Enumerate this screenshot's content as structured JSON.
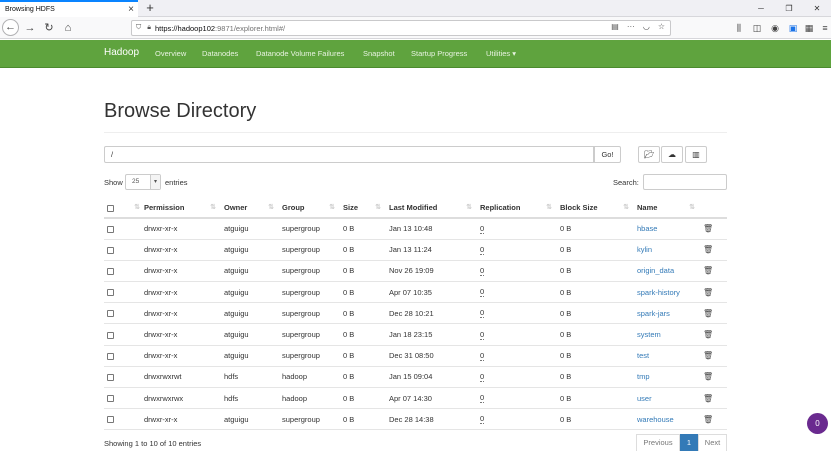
{
  "browser": {
    "tab_title": "Browsing HDFS",
    "tab_close": "×",
    "new_tab": "+",
    "url_host": "https://hadoop102",
    "url_path": ":9871/explorer.html#/",
    "url_more": "···",
    "win_min": "─",
    "win_restore": "❐",
    "win_close": "✕"
  },
  "nav": {
    "brand": "Hadoop",
    "links": [
      "Overview",
      "Datanodes",
      "Datanode Volume Failures",
      "Snapshot",
      "Startup Progress",
      "Utilities ▾"
    ]
  },
  "page": {
    "title": "Browse Directory",
    "path_value": "/",
    "go_label": "Go!",
    "show_label": "Show",
    "entries_value": "25",
    "entries_label": "entries",
    "search_label": "Search:",
    "showing_text": "Showing 1 to 10 of 10 entries",
    "pagination": {
      "previous": "Previous",
      "current": "1",
      "next": "Next"
    },
    "fab_badge": "0"
  },
  "table": {
    "headers": [
      "Permission",
      "Owner",
      "Group",
      "Size",
      "Last Modified",
      "Replication",
      "Block Size",
      "Name"
    ],
    "rows": [
      [
        "drwxr-xr-x",
        "atguigu",
        "supergroup",
        "0 B",
        "Jan 13 10:48",
        "0",
        "0 B",
        "hbase"
      ],
      [
        "drwxr-xr-x",
        "atguigu",
        "supergroup",
        "0 B",
        "Jan 13 11:24",
        "0",
        "0 B",
        "kylin"
      ],
      [
        "drwxr-xr-x",
        "atguigu",
        "supergroup",
        "0 B",
        "Nov 26 19:09",
        "0",
        "0 B",
        "origin_data"
      ],
      [
        "drwxr-xr-x",
        "atguigu",
        "supergroup",
        "0 B",
        "Apr 07 10:35",
        "0",
        "0 B",
        "spark-history"
      ],
      [
        "drwxr-xr-x",
        "atguigu",
        "supergroup",
        "0 B",
        "Dec 28 10:21",
        "0",
        "0 B",
        "spark-jars"
      ],
      [
        "drwxr-xr-x",
        "atguigu",
        "supergroup",
        "0 B",
        "Jan 18 23:15",
        "0",
        "0 B",
        "system"
      ],
      [
        "drwxr-xr-x",
        "atguigu",
        "supergroup",
        "0 B",
        "Dec 31 08:50",
        "0",
        "0 B",
        "test"
      ],
      [
        "drwxrwxrwt",
        "hdfs",
        "hadoop",
        "0 B",
        "Jan 15 09:04",
        "0",
        "0 B",
        "tmp"
      ],
      [
        "drwxrwxrwx",
        "hdfs",
        "hadoop",
        "0 B",
        "Apr 07 14:30",
        "0",
        "0 B",
        "user"
      ],
      [
        "drwxr-xr-x",
        "atguigu",
        "supergroup",
        "0 B",
        "Dec 28 14:38",
        "0",
        "0 B",
        "warehouse"
      ]
    ]
  },
  "colors": {
    "nav_green": "#5fa33e",
    "link_blue": "#337ab7",
    "fab_purple": "#6a2a8f"
  }
}
